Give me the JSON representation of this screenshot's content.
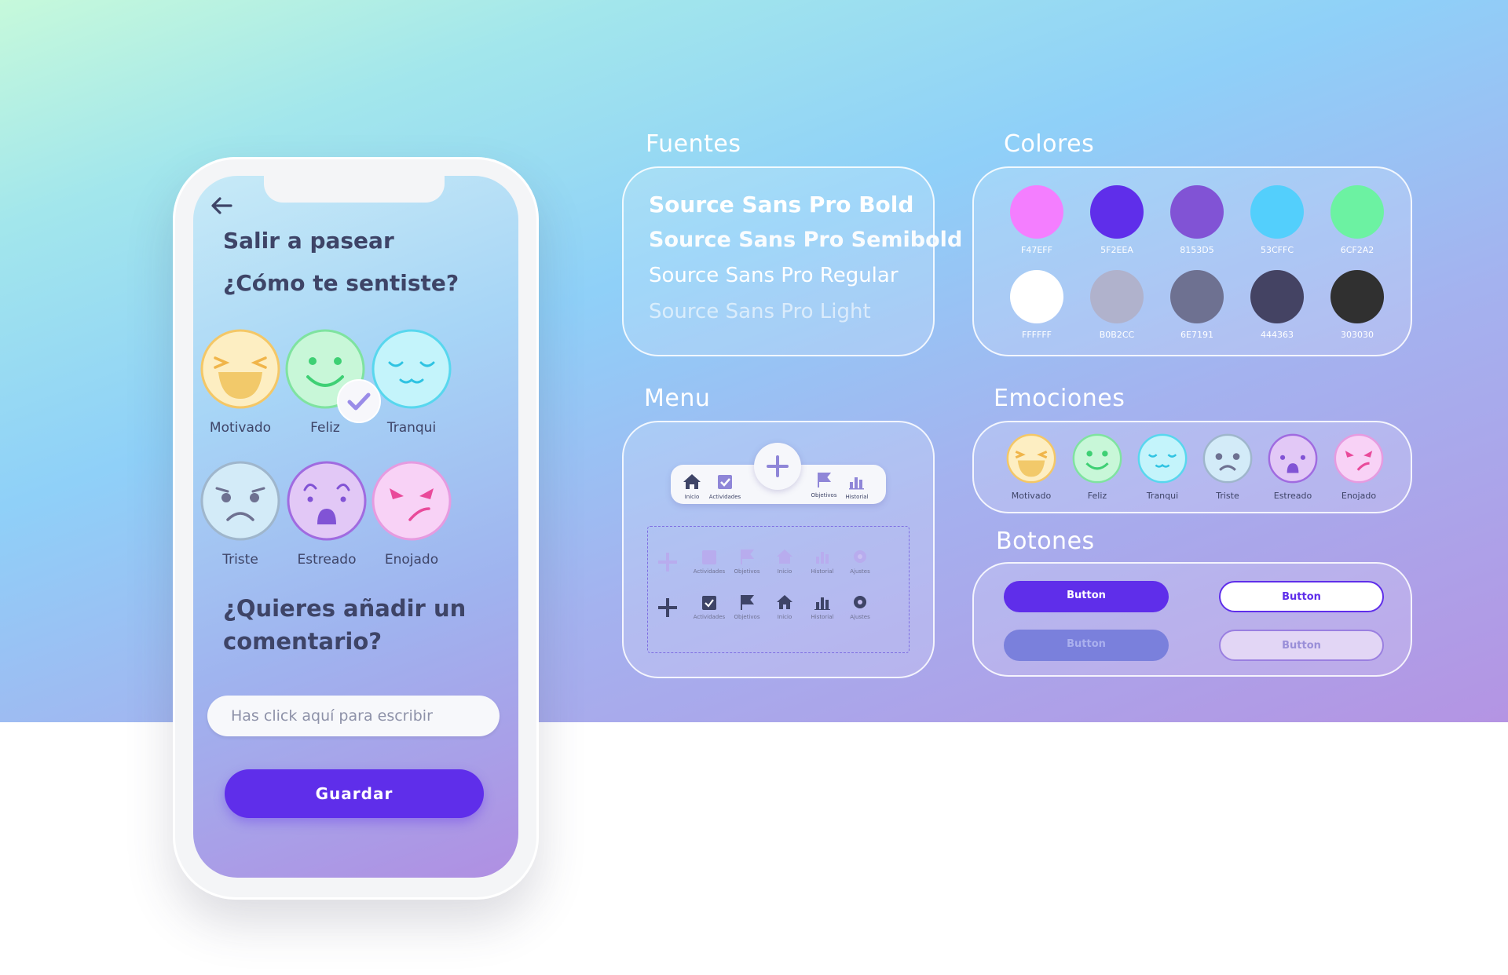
{
  "phone": {
    "title": "Salir a pasear",
    "question": "¿Cómo te sentiste?",
    "emotions": [
      "Motivado",
      "Feliz",
      "Tranqui",
      "Triste",
      "Estreado",
      "Enojado"
    ],
    "selected": "Feliz",
    "comment_question_line1": "¿Quieres añadir un",
    "comment_question_line2": "comentario?",
    "comment_placeholder": "Has click aquí para escribir",
    "save_label": "Guardar"
  },
  "fonts": {
    "title": "Fuentes",
    "lines": [
      "Source Sans Pro Bold",
      "Source Sans Pro Semibold",
      "Source Sans Pro Regular",
      "Source Sans Pro Light"
    ]
  },
  "colors": {
    "title": "Colores",
    "swatches": [
      {
        "hex": "F47EFF",
        "color": "#F47EFF"
      },
      {
        "hex": "5F2EEA",
        "color": "#5F2EEA"
      },
      {
        "hex": "8153D5",
        "color": "#8153D5"
      },
      {
        "hex": "53CFFC",
        "color": "#53CFFC"
      },
      {
        "hex": "6CF2A2",
        "color": "#6CF2A2"
      },
      {
        "hex": "FFFFFF",
        "color": "#FFFFFF"
      },
      {
        "hex": "B0B2CC",
        "color": "#B0B2CC"
      },
      {
        "hex": "6E7191",
        "color": "#6E7191"
      },
      {
        "hex": "444363",
        "color": "#444363"
      },
      {
        "hex": "303030",
        "color": "#303030"
      }
    ]
  },
  "menu": {
    "title": "Menu",
    "nav_items": [
      "Inicio",
      "Actividades",
      "Objetivos",
      "Historial"
    ],
    "icon_labels": [
      "Actividades",
      "Objetivos",
      "Inicio",
      "Historial",
      "Ajustes"
    ]
  },
  "emotions_card": {
    "title": "Emociones",
    "labels": [
      "Motivado",
      "Feliz",
      "Tranqui",
      "Triste",
      "Estreado",
      "Enojado"
    ]
  },
  "buttons_card": {
    "title": "Botones",
    "labels": [
      "Button",
      "Button",
      "Button",
      "Button"
    ]
  }
}
